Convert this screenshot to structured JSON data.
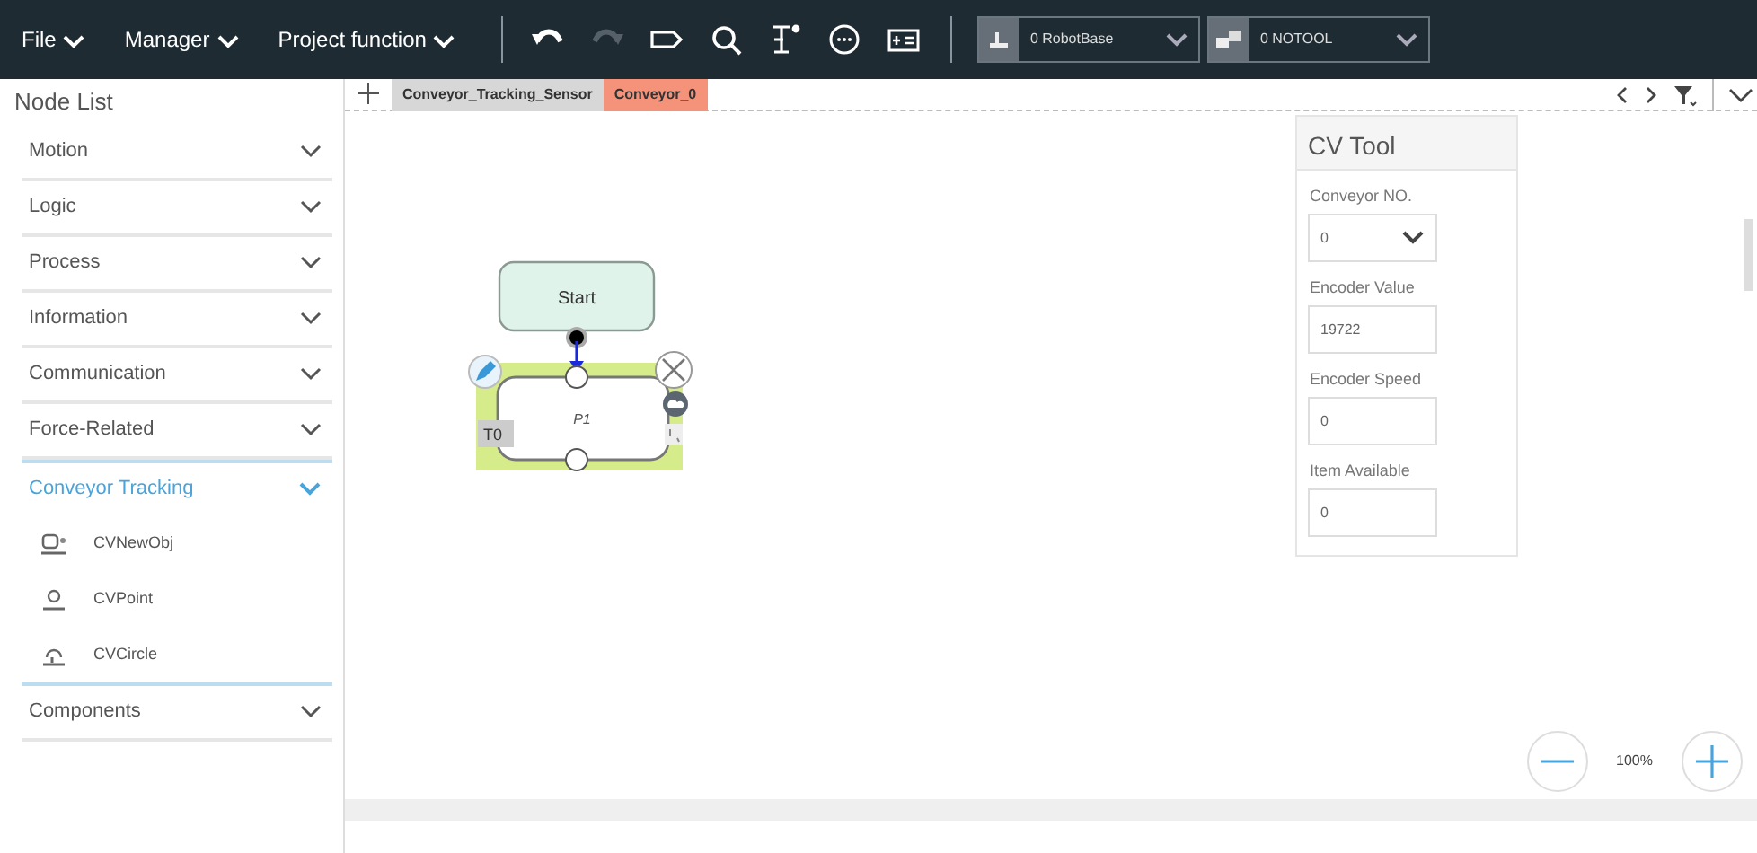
{
  "menu": [
    {
      "label": "File"
    },
    {
      "label": "Manager"
    },
    {
      "label": "Project function"
    }
  ],
  "toolbar": [
    {
      "kind": "undo",
      "disabled": false
    },
    {
      "kind": "redo",
      "disabled": true
    },
    {
      "kind": "shape",
      "disabled": false
    },
    {
      "kind": "search",
      "disabled": false
    },
    {
      "kind": "io",
      "disabled": false
    },
    {
      "kind": "comment",
      "disabled": false
    },
    {
      "kind": "panel",
      "disabled": false
    }
  ],
  "selectors": [
    {
      "kind": "base",
      "label": "0 RobotBase"
    },
    {
      "kind": "tool",
      "label": "0 NOTOOL"
    }
  ],
  "node_list": {
    "title": "Node List",
    "groups": [
      {
        "label": "Motion",
        "expanded": false
      },
      {
        "label": "Logic",
        "expanded": false
      },
      {
        "label": "Process",
        "expanded": false
      },
      {
        "label": "Information",
        "expanded": false
      },
      {
        "label": "Communication",
        "expanded": false
      },
      {
        "label": "Force-Related",
        "expanded": false
      },
      {
        "label": "Conveyor Tracking",
        "expanded": true,
        "children": [
          {
            "kind": "newobj",
            "label": "CVNewObj"
          },
          {
            "kind": "point",
            "label": "CVPoint"
          },
          {
            "kind": "circle",
            "label": "CVCircle"
          }
        ]
      },
      {
        "label": "Components",
        "expanded": false
      }
    ]
  },
  "tabs": [
    {
      "label": "Conveyor_Tracking_Sensor",
      "selected": false
    },
    {
      "label": "Conveyor_0",
      "selected": true
    }
  ],
  "canvas": {
    "nodes": [
      {
        "kind": "start",
        "label": "Start"
      },
      {
        "kind": "point",
        "label": "P1",
        "tool": "T0",
        "selected": true
      }
    ]
  },
  "cv_tool": {
    "title": "CV Tool",
    "fields": [
      {
        "kind": "select",
        "label": "Conveyor NO.",
        "value": "0"
      },
      {
        "kind": "input",
        "label": "Encoder Value",
        "value": "19722"
      },
      {
        "kind": "input",
        "label": "Encoder Speed",
        "value": "0"
      },
      {
        "kind": "input",
        "label": "Item Available",
        "value": "0"
      }
    ]
  },
  "zoom": {
    "reading": "100%"
  }
}
